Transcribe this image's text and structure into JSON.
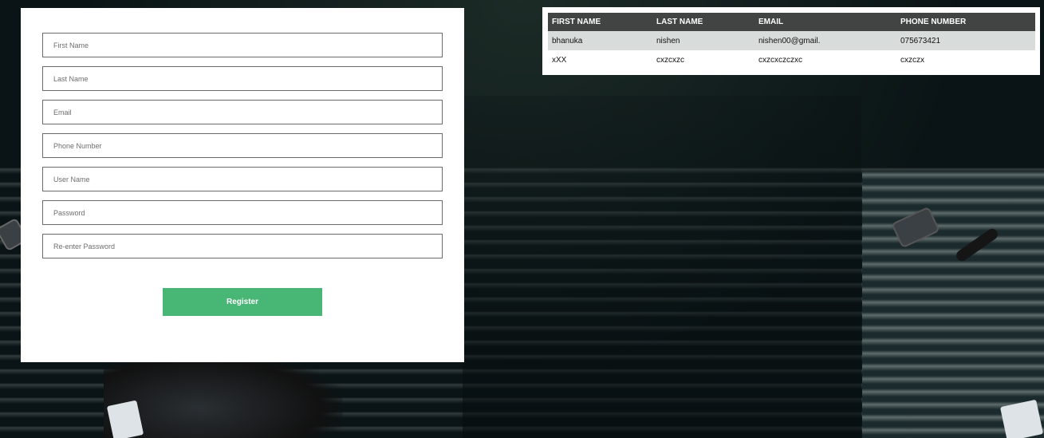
{
  "form": {
    "fields": [
      {
        "placeholder": "First Name",
        "value": ""
      },
      {
        "placeholder": "Last Name",
        "value": ""
      },
      {
        "placeholder": "Email",
        "value": ""
      },
      {
        "placeholder": "Phone Number",
        "value": ""
      },
      {
        "placeholder": "User Name",
        "value": ""
      },
      {
        "placeholder": "Password",
        "value": ""
      },
      {
        "placeholder": "Re-enter Password",
        "value": ""
      }
    ],
    "register_label": "Register"
  },
  "table": {
    "headers": [
      "FIRST NAME",
      "LAST NAME",
      "EMAIL",
      "PHONE NUMBER"
    ],
    "rows": [
      [
        "bhanuka",
        "nishen",
        "nishen00@gmail.",
        "075673421"
      ],
      [
        "xXX",
        "cxzcxzc",
        "cxzcxczczxc",
        "cxzczx"
      ]
    ]
  },
  "colors": {
    "register_button": "#48b674",
    "table_header_bg": "#424443",
    "table_row_alt_bg": "#d8dcdb"
  }
}
